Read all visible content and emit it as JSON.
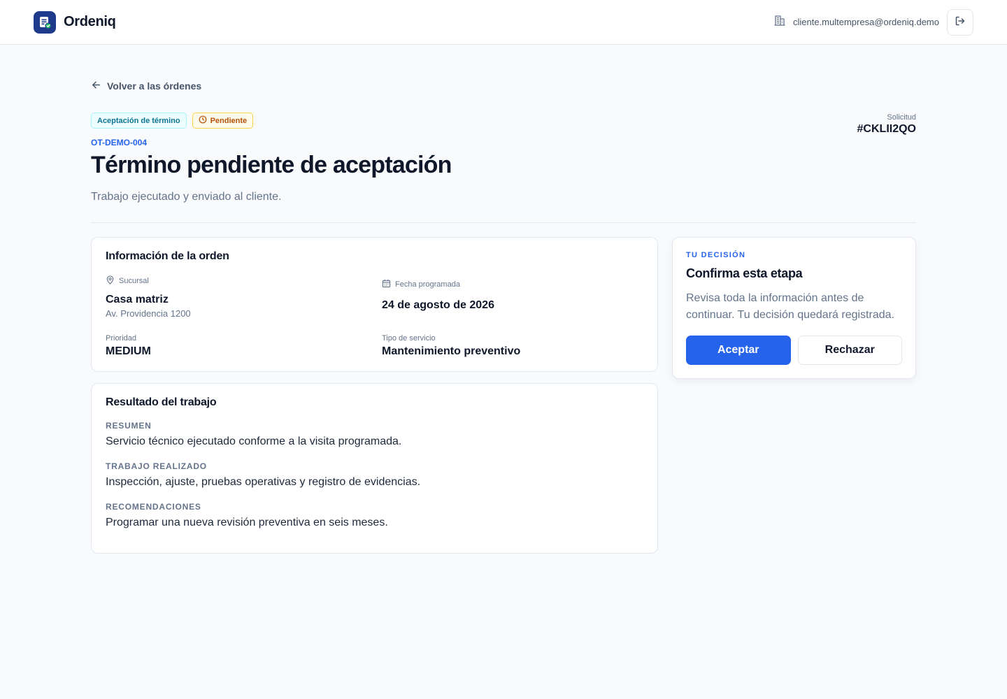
{
  "app": {
    "name": "Ordeniq"
  },
  "user": {
    "email": "cliente.multempresa@ordeniq.demo"
  },
  "nav": {
    "back_label": "Volver a las órdenes"
  },
  "order": {
    "stage_badge": "Aceptación de término",
    "status_badge": "Pendiente",
    "code": "OT-DEMO-004",
    "title": "Término pendiente de aceptación",
    "subtitle": "Trabajo ejecutado y enviado al cliente.",
    "request_label": "Solicitud",
    "request_id": "#CKLII2QO"
  },
  "info_card": {
    "title": "Información de la orden",
    "branch_label": "Sucursal",
    "branch_value": "Casa matriz",
    "branch_address": "Av. Providencia 1200",
    "date_label": "Fecha programada",
    "date_value": "24 de agosto de 2026",
    "priority_label": "Prioridad",
    "priority_value": "MEDIUM",
    "service_label": "Tipo de servicio",
    "service_value": "Mantenimiento preventivo"
  },
  "result_card": {
    "title": "Resultado del trabajo",
    "sections": [
      {
        "label": "RESUMEN",
        "text": "Servicio técnico ejecutado conforme a la visita programada."
      },
      {
        "label": "TRABAJO REALIZADO",
        "text": "Inspección, ajuste, pruebas operativas y registro de evidencias."
      },
      {
        "label": "RECOMENDACIONES",
        "text": "Programar una nueva revisión preventiva en seis meses."
      }
    ]
  },
  "decision": {
    "eyebrow": "TU DECISIÓN",
    "title": "Confirma esta etapa",
    "text": "Revisa toda la información antes de continuar. Tu decisión quedará registrada.",
    "accept_label": "Aceptar",
    "reject_label": "Rechazar"
  },
  "colors": {
    "accent": "#2563eb",
    "brand": "#1e3a8a",
    "stage": "#0e7490",
    "pending": "#b45309"
  },
  "icons": {
    "logo": "document-check-icon",
    "company": "building-icon",
    "logout": "logout-icon",
    "back": "arrow-left-icon",
    "status": "clock-icon",
    "branch": "map-pin-icon",
    "date": "calendar-icon"
  }
}
